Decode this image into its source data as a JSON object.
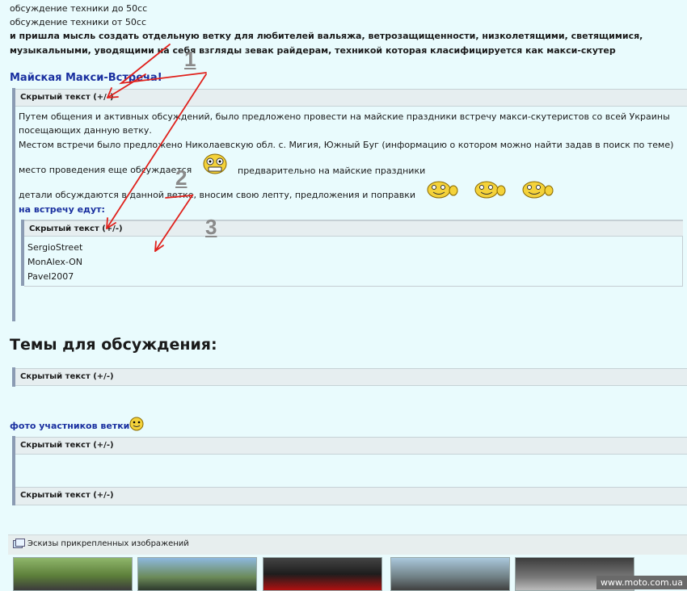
{
  "intro": {
    "line1": "обсуждение техники до 50сс",
    "line2": "обсуждение техники от 50сс",
    "line3": " и пришла мысль создать отдельную ветку для любителей вальяжа, ветрозащищенности, низколетящими, светящимися,",
    "line4": "музыкальными, уводящими на себя взгляды зевак райдерам, техникой которая класифицируется как макси-скутер"
  },
  "meeting": {
    "title": "Майская Макси-Встреча!",
    "spoiler_label": "Скрытый текст (+/-)",
    "p1": "Путем общения и активных обсуждений, было предложено провести на майские праздники встречу макси-скутеристов со всей Украины",
    "p2": "посещающих данную ветку.",
    "p3": "Местом встречи было предложено Николаевскую обл. с. Мигия, Южный Буг (информацию о котором можно найти задав в поиск по теме)",
    "p4a": "место проведения еще обсуждается",
    "p4b": "предварительно на майские праздники",
    "p5": "детали обсуждаются в данной ветке, вносим свою лепту, предложения и поправки",
    "attendees_title": "на встречу едут:",
    "inner_spoiler_label": "Скрытый текст (+/-)",
    "attendees": [
      "SergioStreet",
      "MonAlex-ON",
      "Pavel2007"
    ]
  },
  "topics": {
    "heading": "Темы для обсуждения:",
    "spoiler_label": "Скрытый текст (+/-)"
  },
  "photos": {
    "title": "фото участников ветки",
    "spoiler_label": "Скрытый текст (+/-)",
    "spoiler2_label": "Скрытый текст (+/-)"
  },
  "attachments": {
    "label": "Эскизы прикрепленных изображений"
  },
  "annotations": [
    "1",
    "2",
    "3"
  ],
  "watermark": "www.moto.com.ua",
  "colors": {
    "background": "#e9fbfd",
    "link": "#1a30a0",
    "arrow": "#e0211c"
  }
}
